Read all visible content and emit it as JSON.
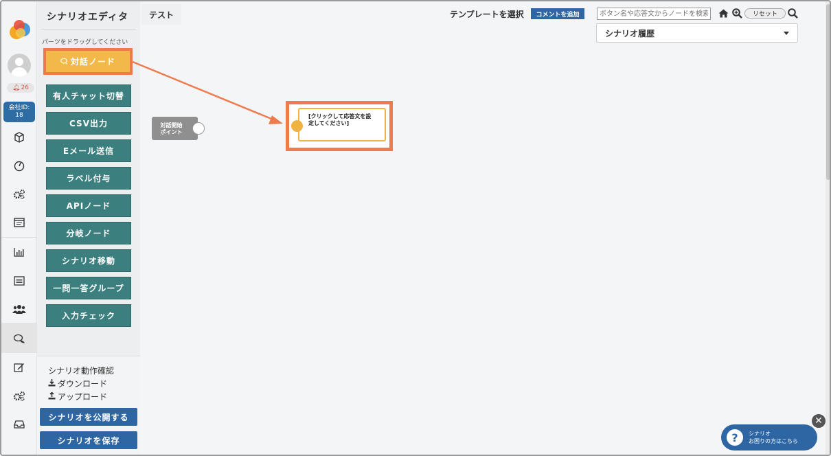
{
  "app": {
    "notification_count": "26",
    "company_id_label": "会社ID:",
    "company_id_value": "18"
  },
  "sidebar": {
    "title": "シナリオエディタ",
    "hint": "パーツをドラッグしてください",
    "dialog_node_label": "対話ノード",
    "parts": [
      "有人チャット切替",
      "CSV出力",
      "Eメール送信",
      "ラベル付与",
      "APIノード",
      "分岐ノード",
      "シナリオ移動",
      "一問一答グループ",
      "入力チェック"
    ],
    "links": {
      "test_run": "シナリオ動作確認",
      "download": "ダウンロード",
      "upload": "アップロード"
    },
    "publish_label": "シナリオを公開する",
    "save_label": "シナリオを保存"
  },
  "toolbar": {
    "tab_label": "テスト",
    "template_label": "テンプレートを選択",
    "comment_label": "コメントを追加",
    "search_placeholder": "ボタン名や応答文からノードを検索",
    "reset_label": "リセット",
    "history_label": "シナリオ履歴"
  },
  "canvas": {
    "start_node_label_line1": "対話開始",
    "start_node_label_line2": "ポイント",
    "dialog_node_text_line1": "[クリックして応答文を設",
    "dialog_node_text_line2": "定してください]"
  },
  "help_widget": {
    "line1": "シナリオ",
    "line2": "お困りの方はこちら",
    "icon": "?"
  },
  "colors": {
    "accent_blue": "#2e66a3",
    "node_teal": "#3c7f7f",
    "dialog_node_yellow": "#f3b84a",
    "highlight_orange": "#ee7b4e"
  }
}
